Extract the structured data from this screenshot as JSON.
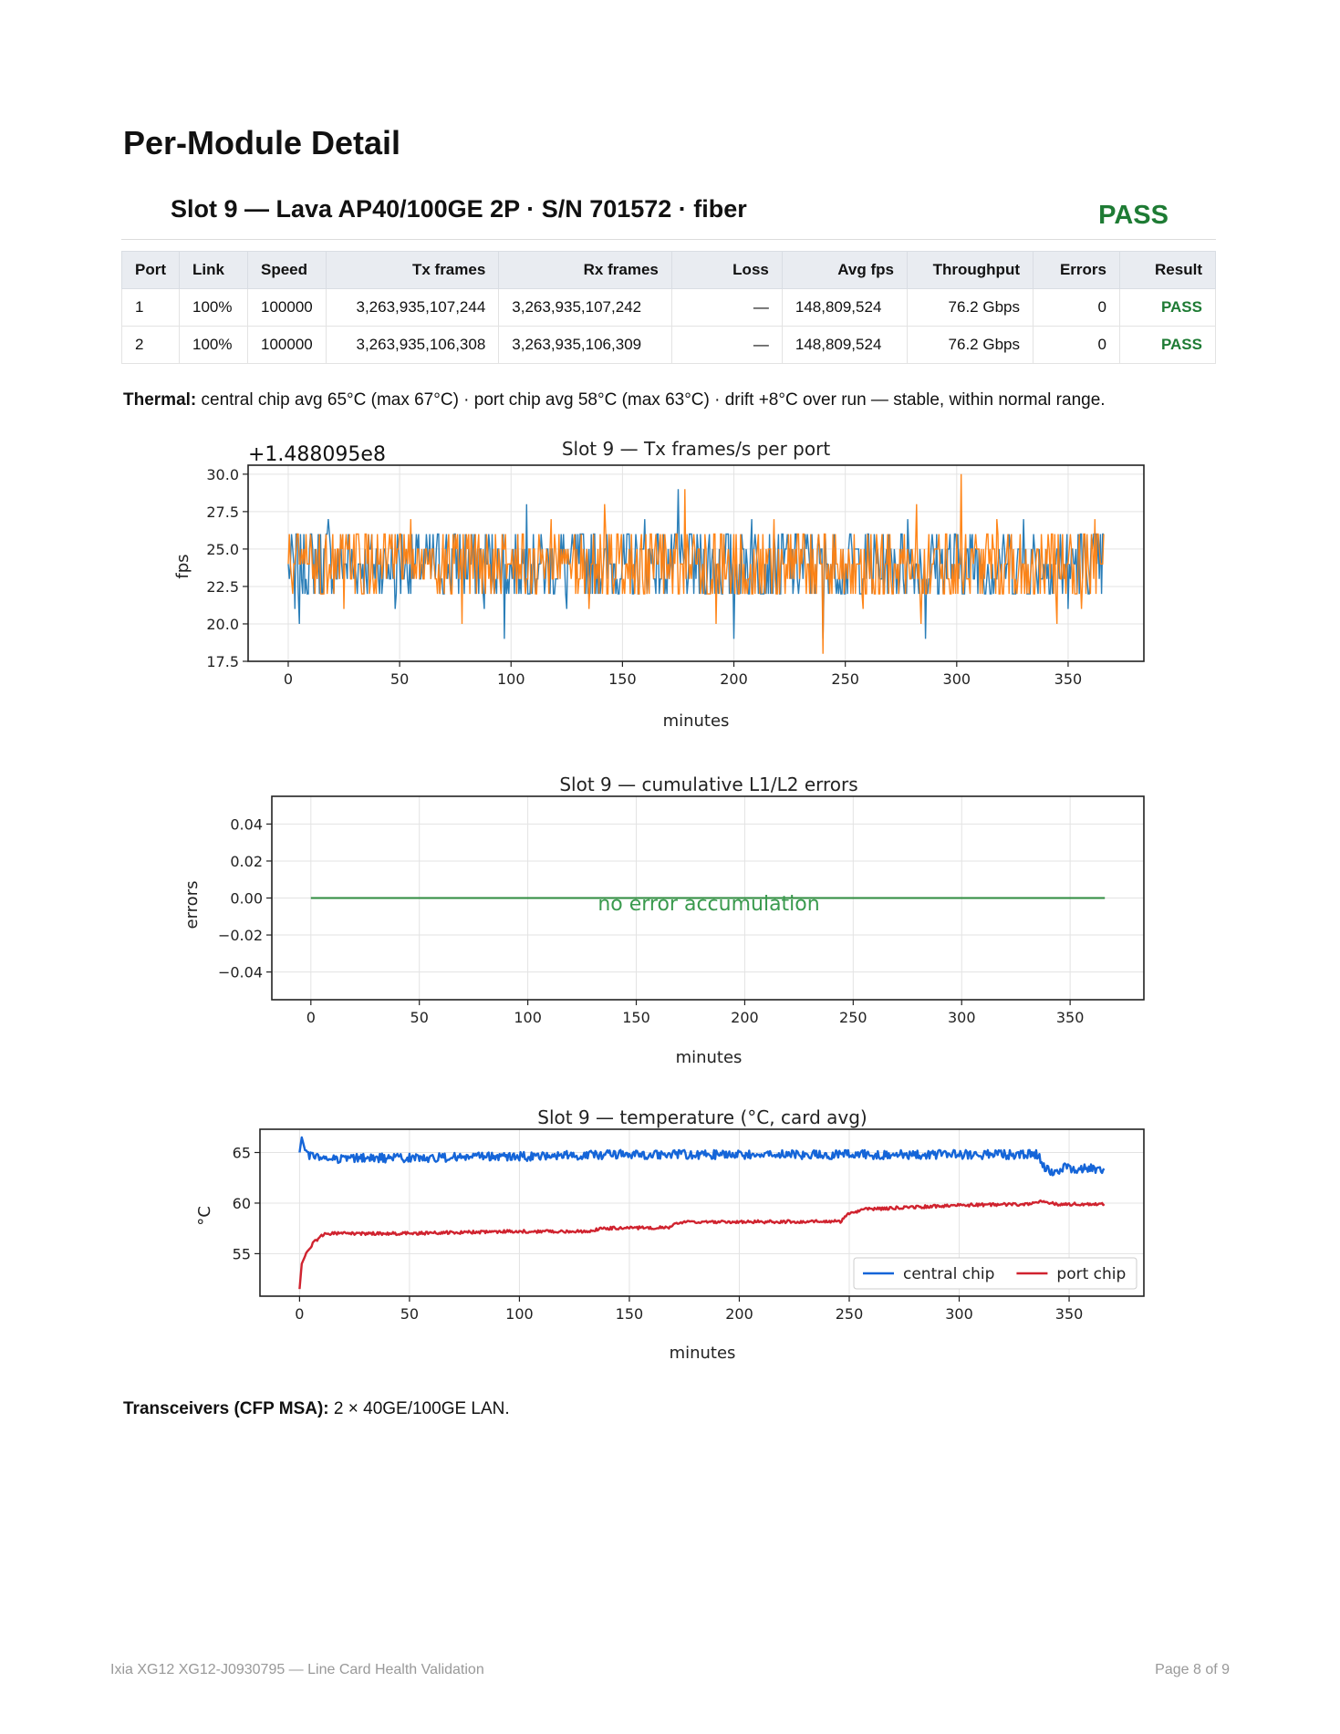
{
  "page": {
    "title": "Per-Module Detail",
    "footer_left": "Ixia XG12 XG12-J0930795 — Line Card Health Validation",
    "footer_right": "Page 8 of 9"
  },
  "slot": {
    "title": "Slot 9 — Lava AP40/100GE 2P · S/N 701572 · fiber",
    "result": "PASS",
    "result_color": "#1e7b34"
  },
  "table": {
    "headers": [
      "Port",
      "Link",
      "Speed",
      "Tx frames",
      "Rx frames",
      "Loss",
      "Avg fps",
      "Throughput",
      "Errors",
      "Result"
    ],
    "rows": [
      [
        "1",
        "100%",
        "100000",
        "3,263,935,107,244",
        "3,263,935,107,242",
        "—",
        "148,809,524",
        "76.2 Gbps",
        "0",
        "PASS"
      ],
      [
        "2",
        "100%",
        "100000",
        "3,263,935,106,308",
        "3,263,935,106,309",
        "—",
        "148,809,524",
        "76.2 Gbps",
        "0",
        "PASS"
      ]
    ]
  },
  "thermal": {
    "label": "Thermal:",
    "text": " central chip avg 65°C (max 67°C) · port chip avg 58°C (max 63°C) · drift +8°C over run — stable, within normal range."
  },
  "transceivers": {
    "label": "Transceivers (CFP MSA):",
    "text": " 2 × 40GE/100GE LAN."
  },
  "chart_data": [
    {
      "type": "line",
      "title": "Slot 9 — Tx frames/s per port",
      "offset_label": "+1.488095e8",
      "xlabel": "minutes",
      "ylabel": "fps",
      "xlim": [
        -18,
        384
      ],
      "ylim": [
        17.5,
        30.6
      ],
      "xticks": [
        0,
        50,
        100,
        150,
        200,
        250,
        300,
        350
      ],
      "xtick_labels": [
        "0",
        "50",
        "100",
        "150",
        "200",
        "250",
        "300",
        "350"
      ],
      "yticks": [
        17.5,
        20.0,
        22.5,
        25.0,
        27.5,
        30.0
      ],
      "ytick_labels": [
        "17.5",
        "20.0",
        "22.5",
        "25.0",
        "27.5",
        "30.0"
      ],
      "grid": true,
      "series": [
        {
          "color": "#1f77b4",
          "band": [
            22,
            26
          ],
          "outliers": [
            [
              3,
              21
            ],
            [
              5,
              20
            ],
            [
              18,
              27
            ],
            [
              48,
              21
            ],
            [
              88,
              21
            ],
            [
              97,
              19
            ],
            [
              107,
              28
            ],
            [
              125,
              21
            ],
            [
              160,
              27
            ],
            [
              175,
              29
            ],
            [
              200,
              19
            ],
            [
              208,
              27
            ],
            [
              240,
              19
            ],
            [
              278,
              27
            ],
            [
              286,
              19
            ],
            [
              330,
              27
            ],
            [
              350,
              21
            ]
          ]
        },
        {
          "color": "#ff7f0e",
          "band": [
            22,
            26
          ],
          "outliers": [
            [
              25,
              21
            ],
            [
              55,
              27
            ],
            [
              78,
              20
            ],
            [
              118,
              27
            ],
            [
              135,
              21
            ],
            [
              142,
              28
            ],
            [
              178,
              29
            ],
            [
              192,
              20
            ],
            [
              218,
              27
            ],
            [
              240,
              18
            ],
            [
              258,
              21
            ],
            [
              282,
              28
            ],
            [
              284,
              20
            ],
            [
              302,
              30
            ],
            [
              318,
              27
            ],
            [
              345,
              20
            ],
            [
              356,
              21
            ],
            [
              362,
              27
            ]
          ]
        }
      ]
    },
    {
      "type": "line",
      "title": "Slot 9 — cumulative L1/L2 errors",
      "annotation": "no error accumulation",
      "xlabel": "minutes",
      "ylabel": "errors",
      "xlim": [
        -18,
        384
      ],
      "ylim": [
        -0.055,
        0.055
      ],
      "xticks": [
        0,
        50,
        100,
        150,
        200,
        250,
        300,
        350
      ],
      "xtick_labels": [
        "0",
        "50",
        "100",
        "150",
        "200",
        "250",
        "300",
        "350"
      ],
      "yticks": [
        -0.04,
        -0.02,
        0.0,
        0.02,
        0.04
      ],
      "ytick_labels": [
        "−0.04",
        "−0.02",
        "0.00",
        "0.02",
        "0.04"
      ],
      "grid": true,
      "series": [
        {
          "color": "#2e8b3e",
          "x": [
            0,
            366
          ],
          "y": [
            0,
            0
          ]
        }
      ]
    },
    {
      "type": "line",
      "title": "Slot 9 — temperature (°C, card avg)",
      "xlabel": "minutes",
      "ylabel": "°C",
      "xlim": [
        -18,
        384
      ],
      "ylim": [
        50.8,
        67.3
      ],
      "xticks": [
        0,
        50,
        100,
        150,
        200,
        250,
        300,
        350
      ],
      "xtick_labels": [
        "0",
        "50",
        "100",
        "150",
        "200",
        "250",
        "300",
        "350"
      ],
      "yticks": [
        55,
        60,
        65
      ],
      "ytick_labels": [
        "55",
        "60",
        "65"
      ],
      "grid": true,
      "legend": "bottom-right",
      "series": [
        {
          "name": "central chip",
          "color": "#1565d8",
          "x": [
            0,
            1,
            3,
            8,
            20,
            60,
            100,
            140,
            180,
            220,
            260,
            300,
            336,
            338,
            342,
            348,
            355,
            366
          ],
          "y": [
            65.0,
            66.5,
            64.8,
            64.5,
            64.4,
            64.5,
            64.6,
            64.8,
            64.8,
            64.8,
            64.8,
            64.8,
            64.8,
            63.8,
            63.0,
            63.5,
            63.4,
            63.4
          ]
        },
        {
          "name": "port chip",
          "color": "#d0232f",
          "x": [
            0,
            1,
            3,
            6,
            9,
            12,
            50,
            95,
            132,
            137,
            168,
            173,
            246,
            250,
            258,
            302,
            332,
            337,
            345,
            366
          ],
          "y": [
            51.5,
            54.0,
            55.0,
            56.0,
            56.6,
            57.0,
            57.0,
            57.2,
            57.2,
            57.5,
            57.6,
            58.1,
            58.2,
            59.0,
            59.4,
            59.8,
            59.9,
            60.2,
            59.9,
            59.9
          ]
        }
      ]
    }
  ]
}
